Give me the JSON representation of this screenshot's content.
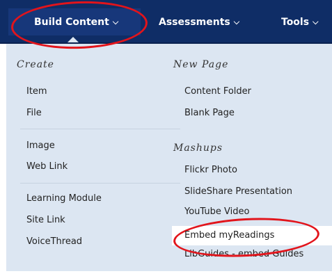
{
  "nav": {
    "items": [
      {
        "label": "Build Content"
      },
      {
        "label": "Assessments"
      },
      {
        "label": "Tools"
      }
    ]
  },
  "menu": {
    "create": {
      "heading": "Create",
      "items": [
        "Item",
        "File",
        "Image",
        "Web Link",
        "Learning Module",
        "Site Link",
        "VoiceThread"
      ]
    },
    "new_page": {
      "heading": "New Page",
      "items": [
        "Content Folder",
        "Blank Page"
      ]
    },
    "mashups": {
      "heading": "Mashups",
      "items": [
        "Flickr Photo",
        "SlideShare Presentation",
        "YouTube Video",
        "Embed myReadings",
        "LibGuides - embed Guides"
      ]
    }
  },
  "colors": {
    "nav_bg": "#0f2d66",
    "nav_active": "#17377a",
    "panel_bg": "#dce6f2",
    "annotation": "#e2141b",
    "highlight": "#ffffff"
  },
  "icons": {
    "dropdown": "chevron-down-icon"
  }
}
